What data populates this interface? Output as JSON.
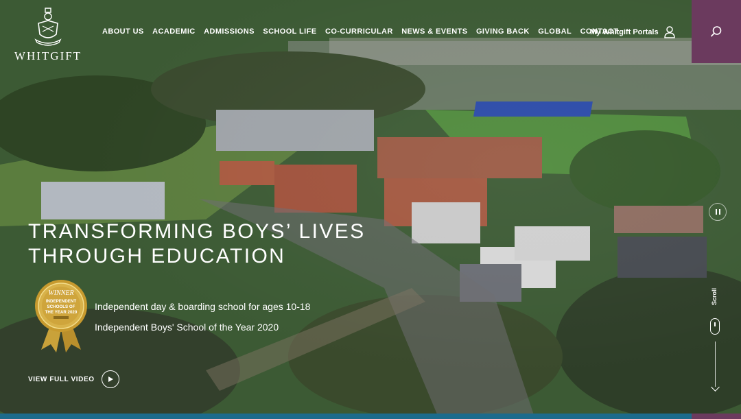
{
  "brand": {
    "name": "WHITGIFT"
  },
  "nav": {
    "items": [
      "ABOUT US",
      "ACADEMIC",
      "ADMISSIONS",
      "SCHOOL LIFE",
      "CO-CURRICULAR",
      "NEWS & EVENTS",
      "GIVING BACK",
      "GLOBAL",
      "CONTACT"
    ],
    "portals_label": "My Whitgift Portals"
  },
  "hero": {
    "headline_line1": "TRANSFORMING BOYS’ LIVES",
    "headline_line2": "THROUGH EDUCATION",
    "tagline1": "Independent day & boarding school for ages 10-18",
    "tagline2": "Independent Boys' School of the Year 2020",
    "video_label": "VIEW FULL VIDEO",
    "scroll_label": "Scroll"
  },
  "award": {
    "top": "WINNER",
    "line1": "INDEPENDENT",
    "line2": "SCHOOLS OF",
    "line3": "THE YEAR 2020"
  },
  "colors": {
    "accent": "#6b3a5e",
    "bar": "#1c6b8c",
    "overlay": "#2a284e"
  },
  "icons": {
    "search": "search-icon",
    "user": "user-icon",
    "pause": "pause-icon",
    "play": "play-icon",
    "scroll": "scroll-mouse-icon"
  }
}
